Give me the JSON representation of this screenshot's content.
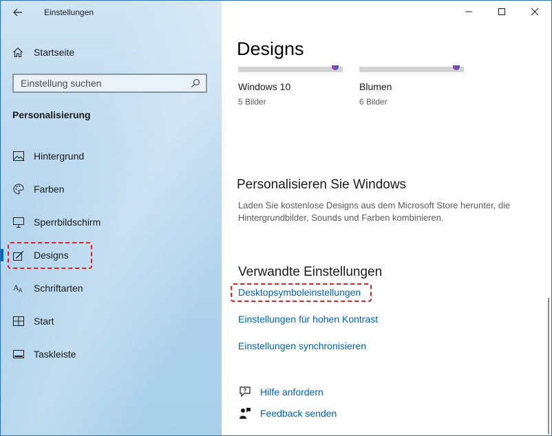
{
  "window": {
    "title": "Einstellungen"
  },
  "sidebar": {
    "home_label": "Startseite",
    "search_placeholder": "Einstellung suchen",
    "section_label": "Personalisierung",
    "items": [
      {
        "label": "Hintergrund",
        "icon": "picture-icon"
      },
      {
        "label": "Farben",
        "icon": "palette-icon"
      },
      {
        "label": "Sperrbildschirm",
        "icon": "monitor-icon"
      },
      {
        "label": "Designs",
        "icon": "brush-icon"
      },
      {
        "label": "Schriftarten",
        "icon": "font-icon"
      },
      {
        "label": "Start",
        "icon": "start-icon"
      },
      {
        "label": "Taskleiste",
        "icon": "taskbar-icon"
      }
    ],
    "active_index": 3
  },
  "main": {
    "page_title": "Designs",
    "themes": [
      {
        "name": "Windows 10",
        "count": "5 Bilder"
      },
      {
        "name": "Blumen",
        "count": "6 Bilder"
      }
    ],
    "personalize": {
      "heading": "Personalisieren Sie Windows",
      "description": "Laden Sie kostenlose Designs aus dem Microsoft Store herunter, die Hintergrundbilder, Sounds und Farben kombinieren."
    },
    "related": {
      "heading": "Verwandte Einstellungen",
      "links": [
        "Desktopsymboleinstellungen",
        "Einstellungen für hohen Kontrast",
        "Einstellungen synchronisieren"
      ]
    },
    "help": {
      "get_help": "Hilfe anfordern",
      "feedback": "Feedback senden"
    }
  },
  "colors": {
    "accent": "#0067c0",
    "link": "#0063b1",
    "highlight": "#e31b23"
  }
}
